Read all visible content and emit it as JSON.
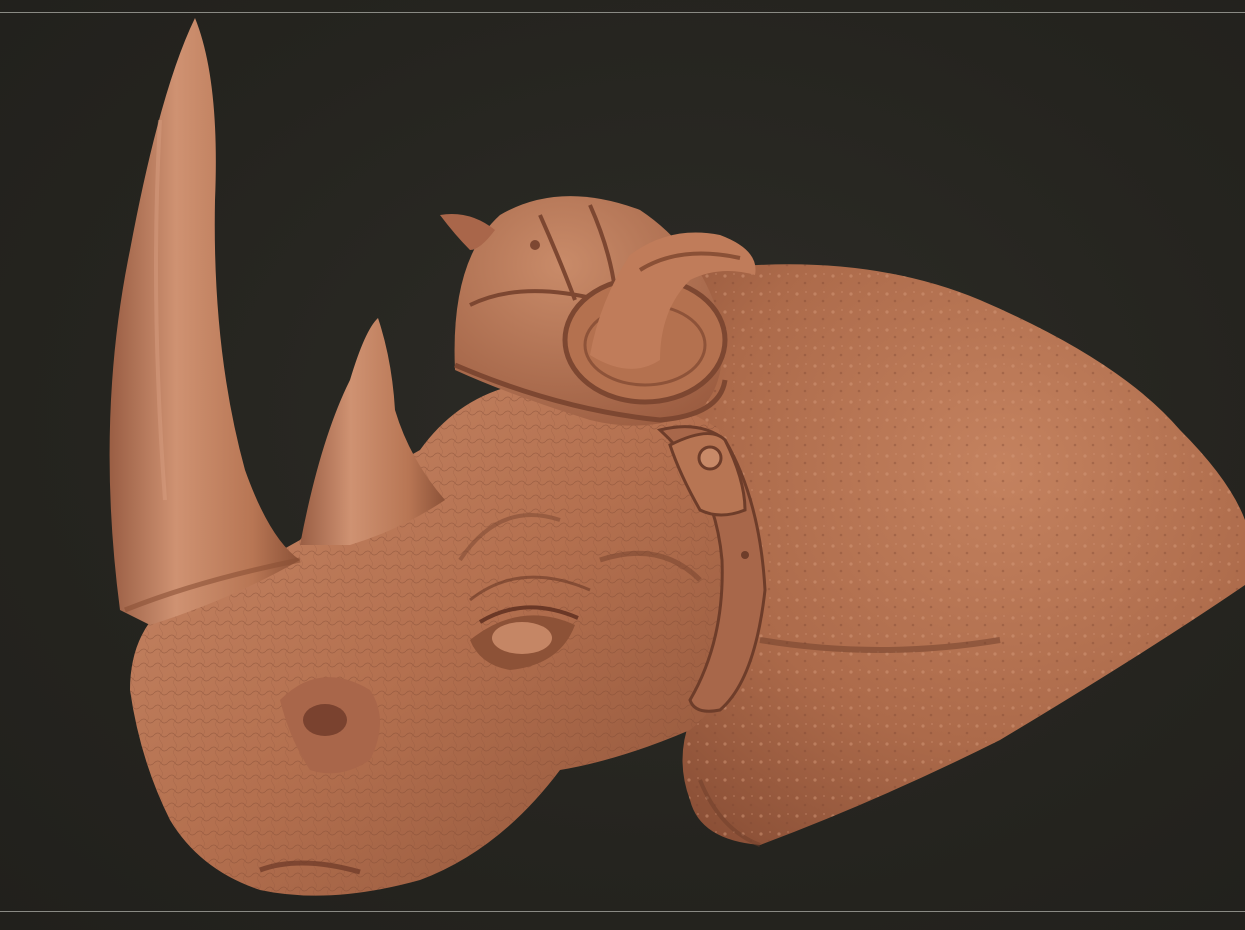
{
  "viewport": {
    "subject": "rhino-head-sculpt",
    "background_color": "#25241f",
    "frame_line_color": "#8a8a84",
    "material_color": "#b8714f"
  }
}
